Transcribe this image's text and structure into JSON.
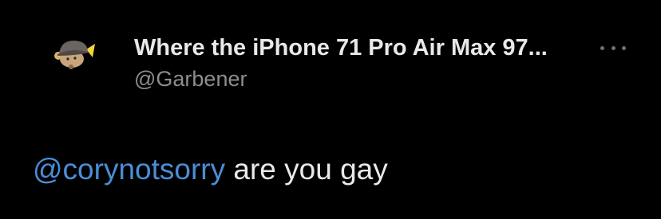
{
  "tweet": {
    "author": {
      "display_name": "Where the iPhone 71 Pro Air Max 97...",
      "handle": "@Garbener",
      "avatar_icon": "cartoon-rat-hat-avatar"
    },
    "more_icon": "more-horizontal-icon",
    "body": {
      "mention": "@corynotsorry",
      "text": " are you gay"
    },
    "colors": {
      "background": "#000000",
      "text": "#e7e9ea",
      "secondary_text": "#8b8d91",
      "mention": "#4a8ed6",
      "icon": "#6e7175"
    }
  }
}
